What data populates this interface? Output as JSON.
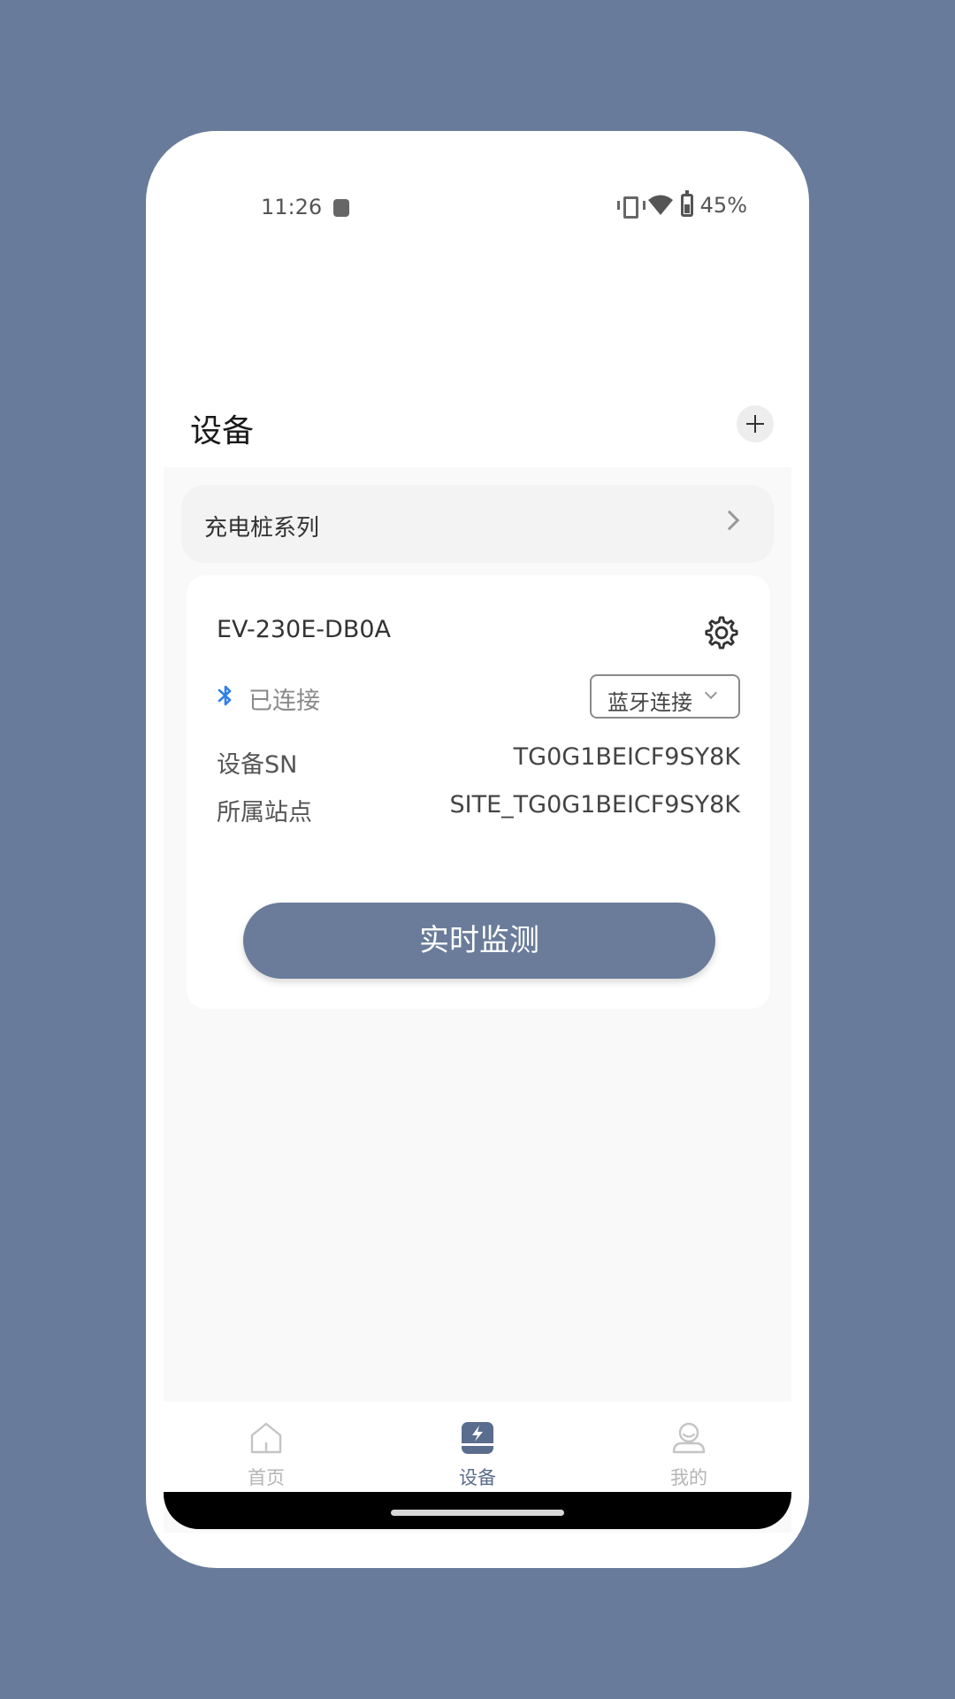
{
  "status_bar": {
    "time": "11:26",
    "battery": "45%"
  },
  "header": {
    "title": "设备"
  },
  "series": {
    "label": "充电桩系列"
  },
  "device": {
    "name": "EV-230E-DB0A",
    "connection_status": "已连接",
    "connect_mode": "蓝牙连接",
    "sn_label": "设备SN",
    "sn_value": "TG0G1BEICF9SY8K",
    "site_label": "所属站点",
    "site_value": "SITE_TG0G1BEICF9SY8K",
    "monitor_button": "实时监测"
  },
  "tabs": [
    {
      "label": "首页",
      "icon": "home-icon",
      "active": false
    },
    {
      "label": "设备",
      "icon": "device-charge-icon",
      "active": true
    },
    {
      "label": "我的",
      "icon": "profile-icon",
      "active": false
    }
  ],
  "colors": {
    "background": "#687b9b",
    "accent": "#6a7c9a",
    "bluetooth": "#2f7fe8",
    "tab_active": "#5a6d8e",
    "tab_inactive": "#b5b5b5"
  }
}
